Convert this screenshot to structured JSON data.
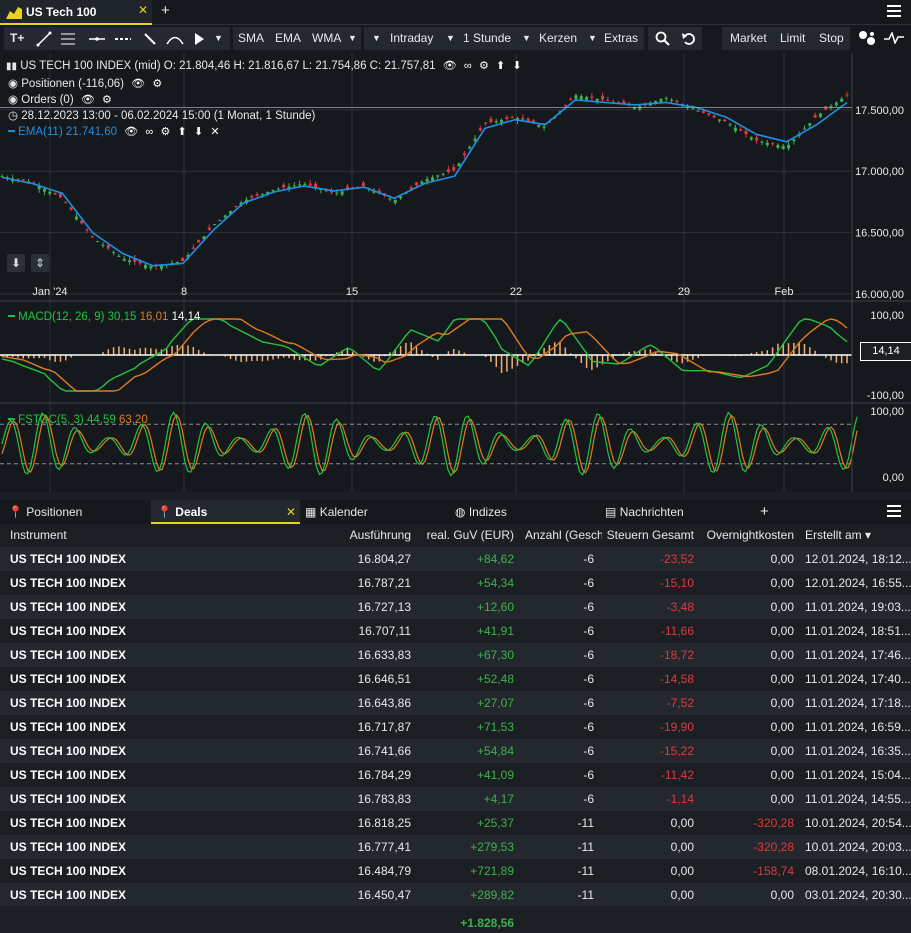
{
  "window": {
    "tab_title": "US Tech 100",
    "tab_close": "✕",
    "add_tab": "+"
  },
  "toolbar": {
    "sma": "SMA",
    "ema": "EMA",
    "wma": "WMA",
    "interval": "Intraday",
    "period": "1 Stunde",
    "style": "Kerzen",
    "extras": "Extras",
    "market": "Market",
    "limit": "Limit",
    "stop": "Stop"
  },
  "chart_legend": {
    "instrument_line": "US TECH 100 INDEX (mid)  O: 21.804,46  H: 21.816,67  L: 21.754,86  C: 21.757,81",
    "positions": "Positionen (-116,06)",
    "orders": "Orders (0)",
    "range": "28.12.2023 13:00 - 06.02.2024 15:00   (1 Monat, 1 Stunde)",
    "ema_label": "EMA(11)",
    "ema_value": "21.741,60",
    "macd_label": "MACD(12, 26, 9)",
    "macd_v1": "30,15",
    "macd_v2": "16,01",
    "macd_v3": "14,14",
    "macd_badge": "14,14",
    "fstoc_label": "FSTOC(5, 3)",
    "fstoc_v1": "44,59",
    "fstoc_v2": "63,20"
  },
  "chart_data": {
    "type": "line",
    "x_ticks": [
      "Jan '24",
      "8",
      "15",
      "22",
      "29",
      "Feb"
    ],
    "y_ticks": [
      "17.500,00",
      "17.000,00",
      "16.500,00",
      "16.000,00"
    ],
    "ylim": [
      16000,
      17800
    ],
    "series": [
      {
        "name": "EMA(11)",
        "color": "#1f8fe8",
        "values": [
          16950,
          16900,
          16820,
          16500,
          16330,
          16230,
          16250,
          16520,
          16740,
          16830,
          16880,
          16840,
          16870,
          16780,
          16900,
          16960,
          17350,
          17420,
          17380,
          17580,
          17560,
          17540,
          17560,
          17520,
          17440,
          17300,
          17240,
          17380,
          17560
        ]
      }
    ],
    "price": [
      16960,
      16910,
      16780,
      16460,
      16290,
      16220,
      16270,
      16560,
      16760,
      16850,
      16900,
      16820,
      16880,
      16760,
      16930,
      17010,
      17390,
      17440,
      17360,
      17620,
      17580,
      17520,
      17600,
      17500,
      17400,
      17250,
      17200,
      17450,
      17620
    ],
    "macd_ylim": [
      -100,
      100
    ],
    "macd_ticks": [
      "100,00",
      "-100,00"
    ],
    "stoc_ticks": [
      "100,00",
      "0,00"
    ]
  },
  "panel_tabs": {
    "positionen": "Positionen",
    "deals": "Deals",
    "deals_close": "✕",
    "kalender": "Kalender",
    "indizes": "Indizes",
    "nachrichten": "Nachrichten",
    "add": "+"
  },
  "table": {
    "headers": {
      "instrument": "Instrument",
      "ausfuehrung": "Ausführung",
      "guv": "real. GuV (EUR)",
      "anzahl": "Anzahl (Geschl",
      "steuern": "Steuern Gesamt",
      "overnight": "Overnightkosten",
      "erstellt": "Erstellt am ▾"
    },
    "rows": [
      {
        "instrument": "US TECH 100 INDEX",
        "ausfuehrung": "16.804,27",
        "guv": "+84,62",
        "anzahl": "-6",
        "steuern": "-23,52",
        "overnight": "0,00",
        "erstellt": "12.01.2024, 18:12..."
      },
      {
        "instrument": "US TECH 100 INDEX",
        "ausfuehrung": "16.787,21",
        "guv": "+54,34",
        "anzahl": "-6",
        "steuern": "-15,10",
        "overnight": "0,00",
        "erstellt": "12.01.2024, 16:55..."
      },
      {
        "instrument": "US TECH 100 INDEX",
        "ausfuehrung": "16.727,13",
        "guv": "+12,60",
        "anzahl": "-6",
        "steuern": "-3,48",
        "overnight": "0,00",
        "erstellt": "11.01.2024, 19:03..."
      },
      {
        "instrument": "US TECH 100 INDEX",
        "ausfuehrung": "16.707,11",
        "guv": "+41,91",
        "anzahl": "-6",
        "steuern": "-11,66",
        "overnight": "0,00",
        "erstellt": "11.01.2024, 18:51..."
      },
      {
        "instrument": "US TECH 100 INDEX",
        "ausfuehrung": "16.633,83",
        "guv": "+67,30",
        "anzahl": "-6",
        "steuern": "-18,72",
        "overnight": "0,00",
        "erstellt": "11.01.2024, 17:46..."
      },
      {
        "instrument": "US TECH 100 INDEX",
        "ausfuehrung": "16.646,51",
        "guv": "+52,48",
        "anzahl": "-6",
        "steuern": "-14,58",
        "overnight": "0,00",
        "erstellt": "11.01.2024, 17:40..."
      },
      {
        "instrument": "US TECH 100 INDEX",
        "ausfuehrung": "16.643,86",
        "guv": "+27,07",
        "anzahl": "-6",
        "steuern": "-7,52",
        "overnight": "0,00",
        "erstellt": "11.01.2024, 17:18..."
      },
      {
        "instrument": "US TECH 100 INDEX",
        "ausfuehrung": "16.717,87",
        "guv": "+71,53",
        "anzahl": "-6",
        "steuern": "-19,90",
        "overnight": "0,00",
        "erstellt": "11.01.2024, 16:59..."
      },
      {
        "instrument": "US TECH 100 INDEX",
        "ausfuehrung": "16.741,66",
        "guv": "+54,84",
        "anzahl": "-6",
        "steuern": "-15,22",
        "overnight": "0,00",
        "erstellt": "11.01.2024, 16:35..."
      },
      {
        "instrument": "US TECH 100 INDEX",
        "ausfuehrung": "16.784,29",
        "guv": "+41,09",
        "anzahl": "-6",
        "steuern": "-11,42",
        "overnight": "0,00",
        "erstellt": "11.01.2024, 15:04..."
      },
      {
        "instrument": "US TECH 100 INDEX",
        "ausfuehrung": "16.783,83",
        "guv": "+4,17",
        "anzahl": "-6",
        "steuern": "-1,14",
        "overnight": "0,00",
        "erstellt": "11.01.2024, 14:55..."
      },
      {
        "instrument": "US TECH 100 INDEX",
        "ausfuehrung": "16.818,25",
        "guv": "+25,37",
        "anzahl": "-11",
        "steuern": "0,00",
        "overnight": "-320,28",
        "erstellt": "10.01.2024, 20:54..."
      },
      {
        "instrument": "US TECH 100 INDEX",
        "ausfuehrung": "16.777,41",
        "guv": "+279,53",
        "anzahl": "-11",
        "steuern": "0,00",
        "overnight": "-320,28",
        "erstellt": "10.01.2024, 20:03..."
      },
      {
        "instrument": "US TECH 100 INDEX",
        "ausfuehrung": "16.484,79",
        "guv": "+721,89",
        "anzahl": "-11",
        "steuern": "0,00",
        "overnight": "-158,74",
        "erstellt": "08.01.2024, 16:10..."
      },
      {
        "instrument": "US TECH 100 INDEX",
        "ausfuehrung": "16.450,47",
        "guv": "+289,82",
        "anzahl": "-11",
        "steuern": "0,00",
        "overnight": "0,00",
        "erstellt": "03.01.2024, 20:30..."
      }
    ],
    "total_guv": "+1.828,56"
  },
  "colors": {
    "accent": "#e8d21d",
    "positive": "#3bb24a",
    "negative": "#e0393e",
    "ema": "#1f8fe8",
    "macd": "#22c33b",
    "signal": "#e07b1f"
  }
}
